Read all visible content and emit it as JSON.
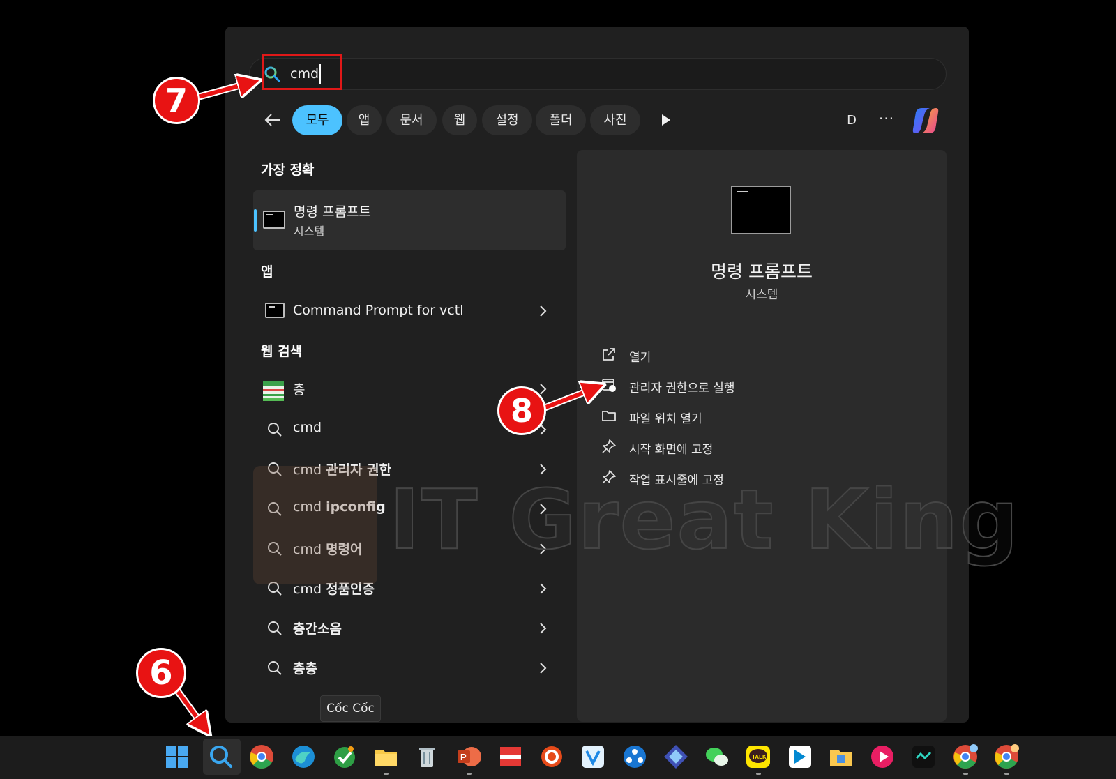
{
  "search": {
    "value": "cmd"
  },
  "filters": [
    {
      "label": "모두",
      "active": true
    },
    {
      "label": "앱"
    },
    {
      "label": "문서"
    },
    {
      "label": "웹"
    },
    {
      "label": "설정"
    },
    {
      "label": "폴더"
    },
    {
      "label": "사진"
    }
  ],
  "account_initial": "D",
  "more_label": "···",
  "sections": {
    "best_match": "가장 정확",
    "apps": "앱",
    "web_search": "웹 검색"
  },
  "best_match": {
    "title": "명령 프롬프트",
    "subtitle": "시스템"
  },
  "apps": [
    {
      "label": "Command Prompt for vctl"
    }
  ],
  "web_results": [
    {
      "prefix": "층",
      "bold": ""
    },
    {
      "prefix": "cmd",
      "bold": ""
    },
    {
      "prefix": "cmd ",
      "bold": "관리자 권한"
    },
    {
      "prefix": "cmd ",
      "bold": "ipconfig"
    },
    {
      "prefix": "cmd ",
      "bold": "명령어"
    },
    {
      "prefix": "cmd ",
      "bold": "정품인증"
    },
    {
      "prefix": "",
      "bold": "층간소음"
    },
    {
      "prefix": "",
      "bold": "층층"
    }
  ],
  "detail": {
    "title": "명령 프롬프트",
    "subtitle": "시스템",
    "actions": [
      {
        "label": "열기",
        "icon": "open-external-icon"
      },
      {
        "label": "관리자 권한으로 실행",
        "icon": "admin-shield-icon"
      },
      {
        "label": "파일 위치 열기",
        "icon": "folder-icon"
      },
      {
        "label": "시작 화면에 고정",
        "icon": "pin-icon"
      },
      {
        "label": "작업 표시줄에 고정",
        "icon": "pin-icon"
      }
    ]
  },
  "tooltip": "Cốc Cốc",
  "watermark": "IT Great King",
  "badges": {
    "six": "6",
    "seven": "7",
    "eight": "8"
  },
  "colors": {
    "accent": "#4cc2ff",
    "annotation": "#e81313",
    "panel": "#202020",
    "detail": "#2b2b2b"
  },
  "taskbar_icons": [
    "windows-start-icon",
    "search-icon",
    "chrome-icon",
    "edge-icon",
    "coccoc-icon",
    "file-explorer-icon",
    "recycle-bin-icon",
    "powerpoint-icon",
    "red-flag-app-icon",
    "record-app-icon",
    "vscode-style-app-icon",
    "network-app-icon",
    "fan-app-icon",
    "wechat-icon",
    "kakaotalk-icon",
    "blue-app-icon",
    "folder-app-icon",
    "media-player-icon",
    "dark-app-icon",
    "chrome-profile-icon",
    "chrome-profile-2-icon"
  ]
}
